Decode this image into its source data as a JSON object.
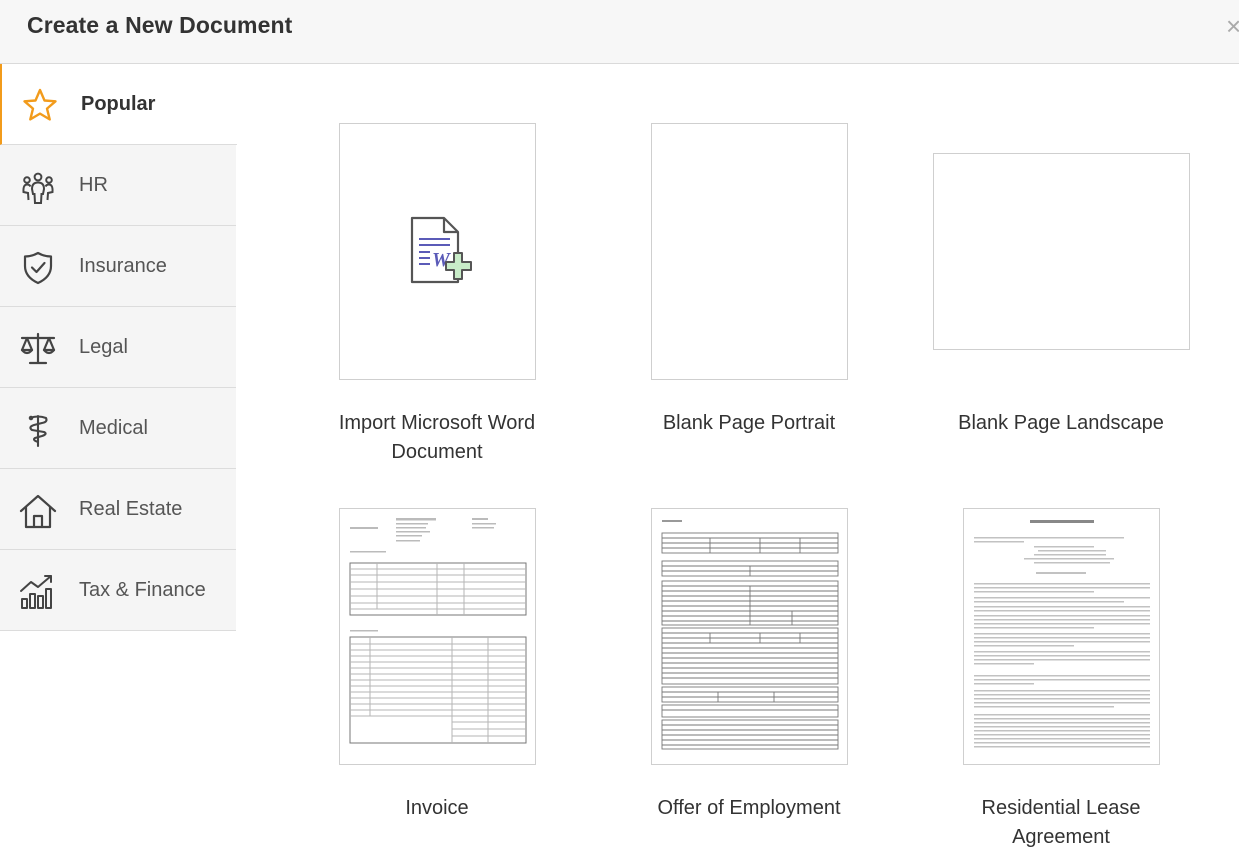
{
  "header": {
    "title": "Create a New Document",
    "close_glyph": "×"
  },
  "sidebar": {
    "items": [
      {
        "label": "Popular",
        "icon": "star-icon",
        "active": true
      },
      {
        "label": "HR",
        "icon": "people-icon"
      },
      {
        "label": "Insurance",
        "icon": "shield-check-icon"
      },
      {
        "label": "Legal",
        "icon": "scales-icon"
      },
      {
        "label": "Medical",
        "icon": "caduceus-icon"
      },
      {
        "label": "Real Estate",
        "icon": "house-icon"
      },
      {
        "label": "Tax & Finance",
        "icon": "finance-chart-icon"
      }
    ]
  },
  "accent_color": "#f29b1b",
  "templates": [
    {
      "label": "Import Microsoft Word Document",
      "thumb": "word-import-icon"
    },
    {
      "label": "Blank Page Portrait",
      "thumb": "blank"
    },
    {
      "label": "Blank Page Landscape",
      "thumb": "blank"
    },
    {
      "label": "Invoice",
      "thumb": "invoice-preview"
    },
    {
      "label": "Offer of Employment",
      "thumb": "offer-preview"
    },
    {
      "label": "Residential Lease Agreement",
      "thumb": "lease-preview"
    }
  ]
}
